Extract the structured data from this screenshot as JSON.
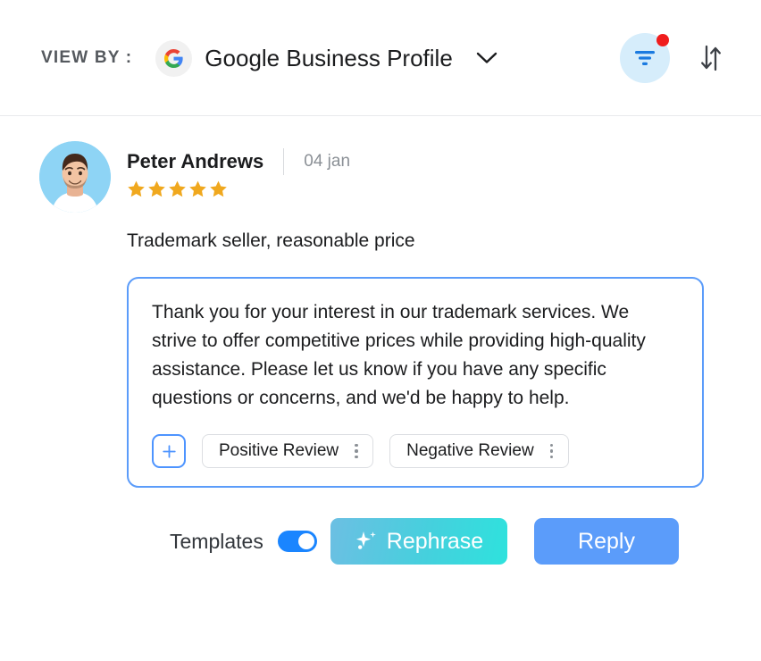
{
  "header": {
    "view_by_label": "VIEW BY :",
    "source_name": "Google Business Profile",
    "source_icon": "google-logo-icon",
    "chevron_icon": "chevron-down-icon",
    "filter_icon": "filter-icon",
    "filter_badge_visible": true,
    "sort_icon": "sort-arrows-icon",
    "accent_blue": "#5b9cfa",
    "filter_circle_color": "#d6edfb",
    "badge_color": "#f01d1d"
  },
  "review": {
    "avatar_icon": "user-avatar-photo",
    "reviewer_name": "Peter Andrews",
    "date": "04 jan",
    "rating": 5,
    "max_rating": 5,
    "star_color": "#f0a81e",
    "text": "Trademark seller, reasonable price"
  },
  "reply": {
    "text": "Thank you for your interest in our trademark services. We strive to offer competitive prices while providing high-quality assistance. Please let us know if you have any specific questions or concerns, and we'd be happy to help.",
    "border_color": "#5b9cfa",
    "add_button_label": "+",
    "templates": [
      {
        "label": "Positive Review",
        "menu_icon": "more-vertical-icon"
      },
      {
        "label": "Negative Review",
        "menu_icon": "more-vertical-icon"
      }
    ]
  },
  "actions": {
    "templates_label": "Templates",
    "templates_toggle_on": true,
    "toggle_color": "#1a85ff",
    "rephrase_label": "Rephrase",
    "rephrase_icon": "sparkle-icon",
    "rephrase_gradient_from": "#6cbfe3",
    "rephrase_gradient_to": "#2ee2dd",
    "reply_label": "Reply",
    "reply_color": "#5b9cfa"
  }
}
